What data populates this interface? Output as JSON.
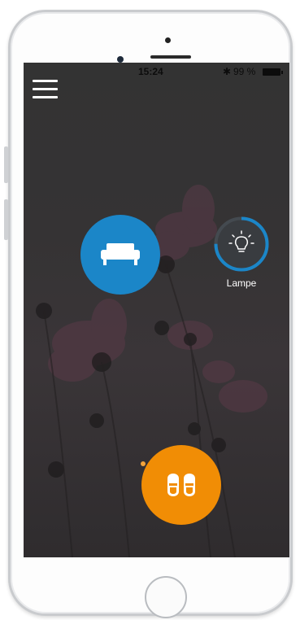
{
  "status_bar": {
    "time": "15:24",
    "bluetooth": "✱",
    "battery_percent": "99 %"
  },
  "scenes": {
    "lamp": {
      "label": "Lampe",
      "level": 0.75
    }
  },
  "colors": {
    "sofa": "#1b86c8",
    "slippers": "#f18d05",
    "lamp_ring": "#1b86c8",
    "lamp_track": "#444a50"
  },
  "icons": {
    "menu": "hamburger-icon",
    "sofa": "sofa-icon",
    "lamp": "light-bulb-icon",
    "slippers": "slippers-icon"
  }
}
